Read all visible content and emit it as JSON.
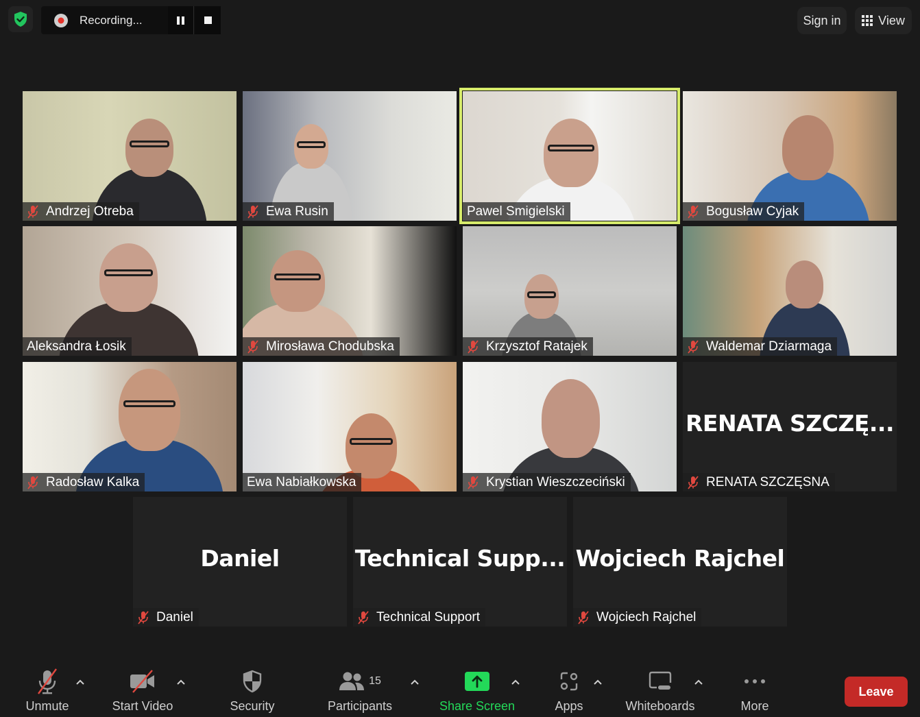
{
  "top_bar": {
    "security_shield_color": "#22c55e",
    "recording_label": "Recording...",
    "sign_in_label": "Sign in",
    "view_label": "View"
  },
  "participants_grid": [
    {
      "name": "Andrzej Otreba",
      "muted": true,
      "video": true,
      "active_speaker": false
    },
    {
      "name": "Ewa Rusin",
      "muted": true,
      "video": true,
      "active_speaker": false
    },
    {
      "name": "Pawel Smigielski",
      "muted": false,
      "video": true,
      "active_speaker": true
    },
    {
      "name": "Bogusław Cyjak",
      "muted": true,
      "video": true,
      "active_speaker": false
    },
    {
      "name": "Aleksandra Łosik",
      "muted": false,
      "video": true,
      "active_speaker": false
    },
    {
      "name": "Mirosława Chodubska",
      "muted": true,
      "video": true,
      "active_speaker": false
    },
    {
      "name": "Krzysztof Ratajek",
      "muted": true,
      "video": true,
      "active_speaker": false
    },
    {
      "name": "Waldemar Dziarmaga",
      "muted": true,
      "video": true,
      "active_speaker": false
    },
    {
      "name": "Radosław Kalka",
      "muted": true,
      "video": true,
      "active_speaker": false
    },
    {
      "name": "Ewa Nabiałkowska",
      "muted": false,
      "video": true,
      "active_speaker": false
    },
    {
      "name": "Krystian Wieszczeciński",
      "muted": true,
      "video": true,
      "active_speaker": false
    },
    {
      "name": "RENATA SZCZĘSNA",
      "display_name": "RENATA  SZCZĘ...",
      "muted": true,
      "video": false,
      "active_speaker": false
    },
    {
      "name": "Daniel",
      "display_name": "Daniel",
      "muted": true,
      "video": false,
      "active_speaker": false
    },
    {
      "name": "Technical Support",
      "display_name": "Technical  Supp...",
      "muted": true,
      "video": false,
      "active_speaker": false
    },
    {
      "name": "Wojciech Rajchel",
      "display_name": "Wojciech Rajchel",
      "muted": true,
      "video": false,
      "active_speaker": false
    }
  ],
  "active_speaker_border_color": "#d7ec6b",
  "toolbar": {
    "unmute_label": "Unmute",
    "start_video_label": "Start Video",
    "security_label": "Security",
    "participants_label": "Participants",
    "participants_count": "15",
    "share_screen_label": "Share Screen",
    "share_screen_color": "#23d959",
    "apps_label": "Apps",
    "whiteboards_label": "Whiteboards",
    "more_label": "More",
    "leave_label": "Leave",
    "leave_color": "#c42a27"
  }
}
